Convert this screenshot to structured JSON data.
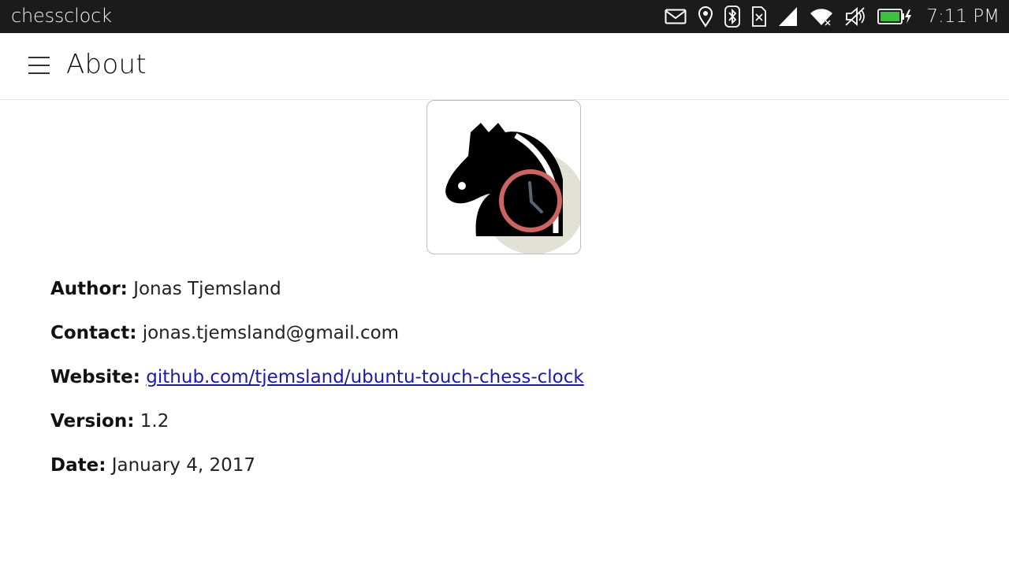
{
  "status_bar": {
    "app_name": "chessclock",
    "time": "7:11 PM",
    "icons": [
      "mail-icon",
      "location-icon",
      "bluetooth-icon",
      "sim-icon",
      "signal-icon",
      "wifi-icon",
      "volume-muted-icon",
      "battery-charging-icon"
    ]
  },
  "header": {
    "menu_icon": "hamburger-menu-icon",
    "title": "About"
  },
  "app_icon": "chess-knight-clock-logo",
  "info": {
    "author_label": "Author:",
    "author_value": "Jonas Tjemsland",
    "contact_label": "Contact:",
    "contact_value": "jonas.tjemsland@gmail.com",
    "website_label": "Website:",
    "website_value": "github.com/tjemsland/ubuntu-touch-chess-clock",
    "version_label": "Version:",
    "version_value": "1.2",
    "date_label": "Date:",
    "date_value": "January 4, 2017"
  },
  "colors": {
    "status_bar_bg": "#1b1b1b",
    "link": "#1a1aa8",
    "logo_circle": "#e2e1d5",
    "clock_ring": "#cc6464"
  }
}
